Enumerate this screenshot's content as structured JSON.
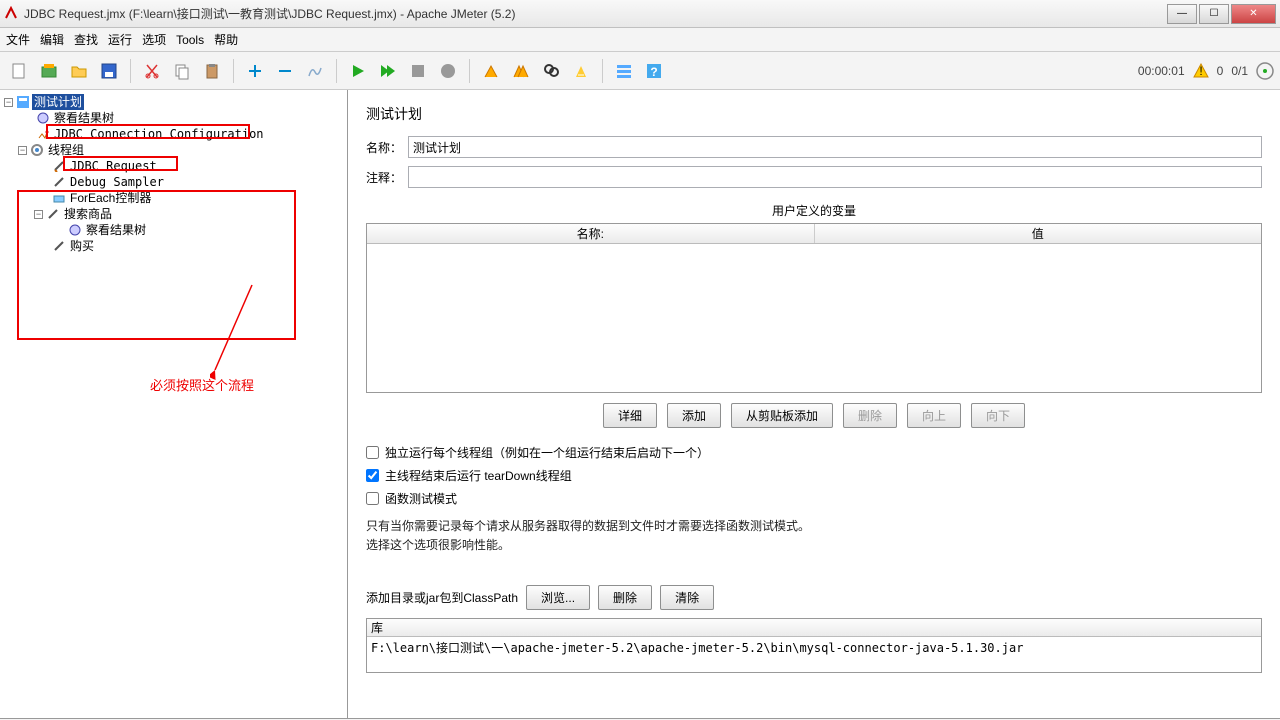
{
  "window": {
    "title": "JDBC Request.jmx (F:\\learn\\接口测试\\一教育测试\\JDBC Request.jmx) - Apache JMeter (5.2)"
  },
  "menu": {
    "file": "文件",
    "edit": "编辑",
    "search": "查找",
    "run": "运行",
    "options": "选项",
    "tools": "Tools",
    "help": "帮助"
  },
  "status": {
    "time": "00:00:01",
    "errors": "0",
    "threads": "0/1"
  },
  "tree": {
    "root": "测试计划",
    "n1": "察看结果树",
    "n2": "JDBC Connection Configuration",
    "n3": "线程组",
    "n4": "JDBC Request",
    "n5": "Debug Sampler",
    "n6": "ForEach控制器",
    "n7": "搜索商品",
    "n8": "察看结果树",
    "n9": "购买"
  },
  "annotation": "必须按照这个流程",
  "panel": {
    "title": "测试计划",
    "name_label": "名称：",
    "name_value": "测试计划",
    "comment_label": "注释：",
    "comment_value": "",
    "vars_title": "用户定义的变量",
    "col_name": "名称:",
    "col_value": "值",
    "btn_detail": "详细",
    "btn_add": "添加",
    "btn_clipboard": "从剪贴板添加",
    "btn_delete": "删除",
    "btn_up": "向上",
    "btn_down": "向下",
    "cb1": "独立运行每个线程组（例如在一个组运行结束后启动下一个）",
    "cb2": "主线程结束后运行 tearDown线程组",
    "cb3": "函数测试模式",
    "info1": "只有当你需要记录每个请求从服务器取得的数据到文件时才需要选择函数测试模式。",
    "info2": "选择这个选项很影响性能。",
    "classpath_label": "添加目录或jar包到ClassPath",
    "btn_browse": "浏览...",
    "btn_del2": "删除",
    "btn_clear": "清除",
    "lib_header": "库",
    "lib_path": "F:\\learn\\接口测试\\一\\apache-jmeter-5.2\\apache-jmeter-5.2\\bin\\mysql-connector-java-5.1.30.jar"
  }
}
